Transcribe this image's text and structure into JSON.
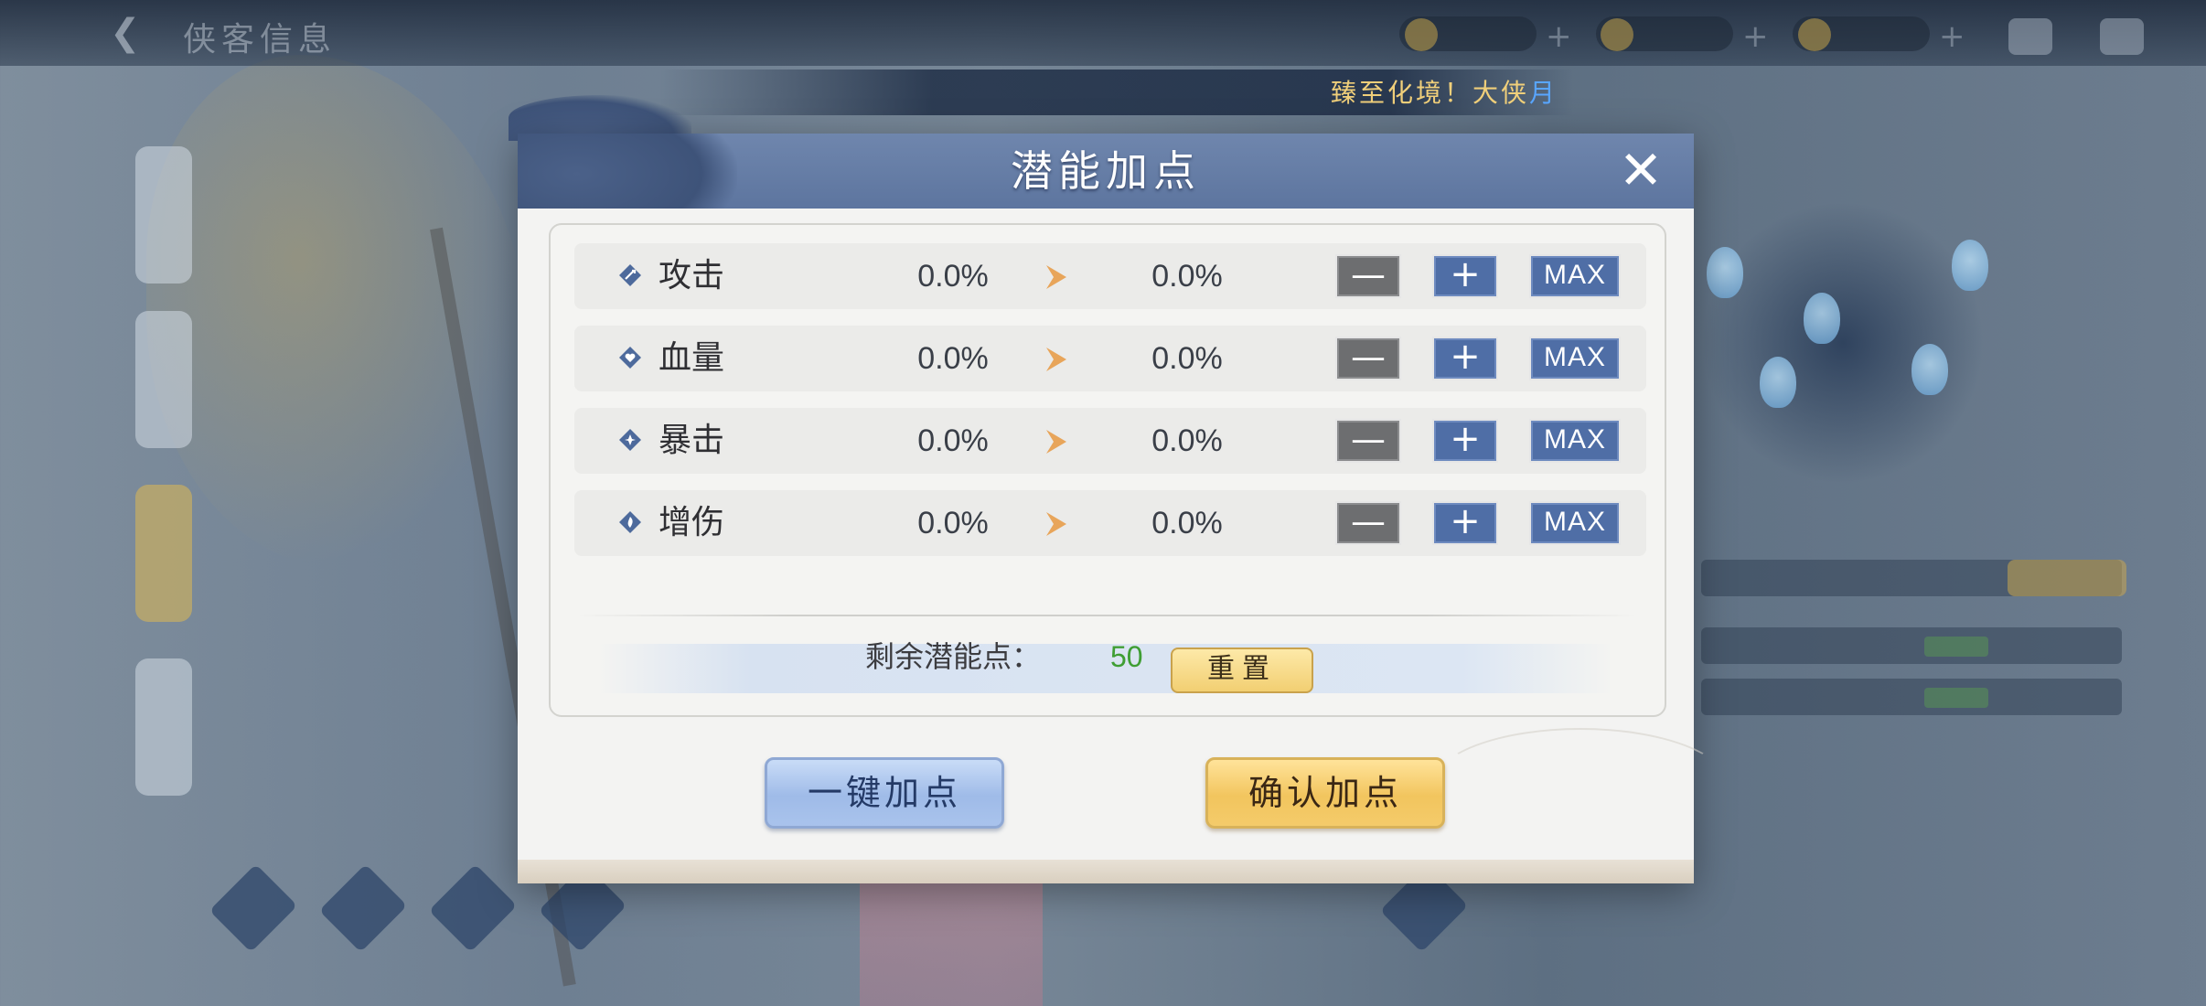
{
  "background": {
    "back_title": "侠客信息",
    "ticker": "臻至化境！大侠",
    "ticker_overflow": "月"
  },
  "dialog": {
    "title": "潜能加点",
    "stats": [
      {
        "name": "攻击",
        "current": "0.0%",
        "next": "0.0%",
        "icon": "sword-diamond-icon"
      },
      {
        "name": "血量",
        "current": "0.0%",
        "next": "0.0%",
        "icon": "heart-diamond-icon"
      },
      {
        "name": "暴击",
        "current": "0.0%",
        "next": "0.0%",
        "icon": "burst-diamond-icon"
      },
      {
        "name": "增伤",
        "current": "0.0%",
        "next": "0.0%",
        "icon": "flame-diamond-icon"
      }
    ],
    "buttons": {
      "minus": "—",
      "plus": "+",
      "max": "MAX",
      "reset": "重置",
      "auto": "一键加点",
      "confirm": "确认加点"
    },
    "remaining": {
      "label": "剩余潜能点：",
      "value": "50"
    }
  },
  "colors": {
    "header": "#5d759f",
    "plus_button": "#4f6ea6",
    "minus_button": "#6d6e70",
    "remaining_value": "#3f9e34",
    "arrow": "#e8a55a",
    "ticker_text": "#f0cf7a"
  }
}
